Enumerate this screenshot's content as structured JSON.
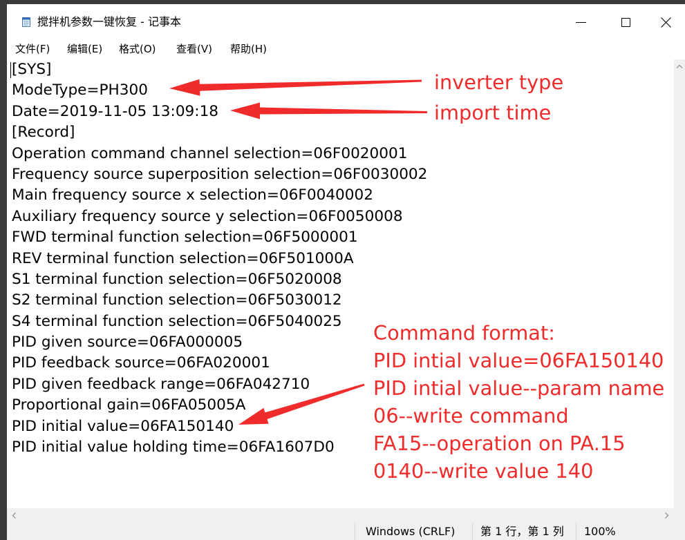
{
  "window": {
    "title": "搅拌机参数一键恢复 - 记事本",
    "app_icon": "notepad-icon",
    "controls": [
      "minimize-icon",
      "maximize-icon",
      "close-icon"
    ]
  },
  "menu": {
    "file": "文件(F)",
    "edit": "编辑(E)",
    "format": "格式(O)",
    "view": "查看(V)",
    "help": "帮助(H)"
  },
  "editor": {
    "lines": [
      "[SYS]",
      "ModeType=PH300",
      "Date=2019-11-05 13:09:18",
      "[Record]",
      "Operation command channel selection=06F0020001",
      "Frequency source superposition selection=06F0030002",
      "Main frequency source x selection=06F0040002",
      "Auxiliary frequency source y selection=06F0050008",
      "FWD terminal function selection=06F5000001",
      "REV terminal function selection=06F501000A",
      "S1 terminal function selection=06F5020008",
      "S2 terminal function selection=06F5030012",
      "S4 terminal function selection=06F5040025",
      "PID given source=06FA000005",
      "PID feedback source=06FA020001",
      "PID given feedback range=06FA042710",
      "Proportional gain=06FA05005A",
      "PID initial value=06FA150140",
      "PID initial value holding time=06FA1607D0"
    ]
  },
  "scrollbars": {
    "vertical": [
      "chevron-up-icon"
    ],
    "horizontal": [
      "chevron-left-icon",
      "chevron-right-icon"
    ]
  },
  "status_bar": {
    "line_ending": "Windows (CRLF)",
    "cursor_position": "第 1 行，第 1 列",
    "zoom": "100%"
  },
  "annotations": {
    "inverter_type": "inverter type",
    "import_time": "import time",
    "command_format": {
      "heading": "Command format:",
      "lines": [
        "PID intial value=06FA150140",
        "PID intial value--param name",
        "06--write command",
        "FA15--operation on PA.15",
        "0140--write value 140"
      ]
    }
  },
  "colors": {
    "annotation_red": "#f02b2b",
    "chrome_gray": "#f0f0f0",
    "frame_dark": "#3a3a3a"
  }
}
